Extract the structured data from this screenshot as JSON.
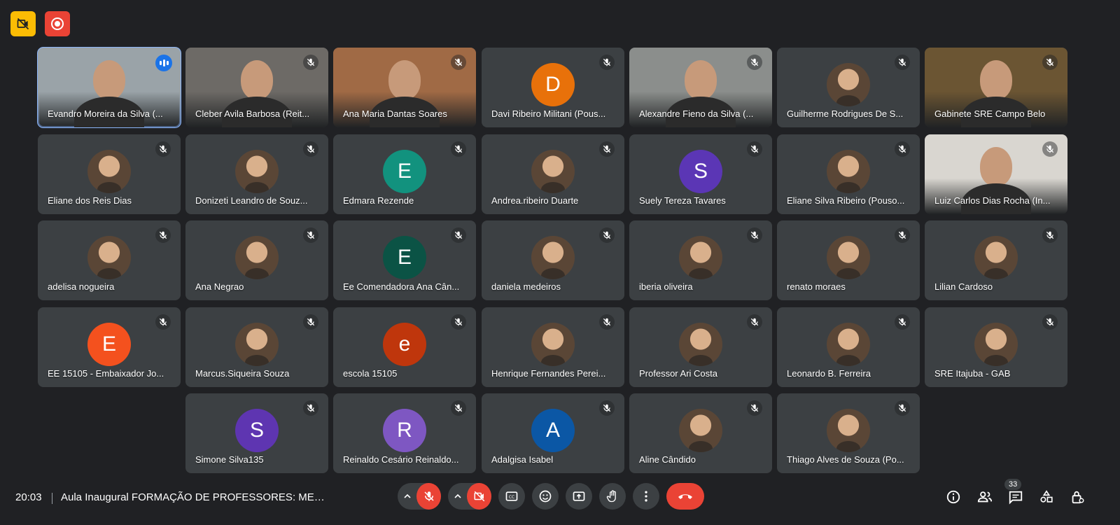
{
  "top_badges": {
    "camera_off": "camera-off-icon",
    "recording": "record-icon"
  },
  "participants": [
    {
      "name": "Evandro Moreira da Silva (...",
      "kind": "video",
      "bg": "#9aa3a8",
      "speaking": true
    },
    {
      "name": "Cleber Avila Barbosa (Reit...",
      "kind": "video",
      "bg": "#6d6a66"
    },
    {
      "name": "Ana Maria Dantas Soares",
      "kind": "video",
      "bg": "#a06a45"
    },
    {
      "name": "Davi Ribeiro Militani (Pous...",
      "kind": "letter",
      "letter": "D",
      "color": "#e8710a"
    },
    {
      "name": "Alexandre Fieno da Silva (...",
      "kind": "video",
      "bg": "#8b8e8c"
    },
    {
      "name": "Guilherme Rodrigues De S...",
      "kind": "photo"
    },
    {
      "name": "Gabinete SRE Campo Belo",
      "kind": "video",
      "bg": "#6b5533"
    },
    {
      "name": "Eliane dos Reis Dias",
      "kind": "photo"
    },
    {
      "name": "Donizeti Leandro de Souz...",
      "kind": "photo"
    },
    {
      "name": "Edmara Rezende",
      "kind": "letter",
      "letter": "E",
      "color": "#12927e"
    },
    {
      "name": "Andrea.ribeiro Duarte",
      "kind": "photo"
    },
    {
      "name": "Suely Tereza Tavares",
      "kind": "letter",
      "letter": "S",
      "color": "#5b36b5"
    },
    {
      "name": "Eliane Silva Ribeiro (Pouso...",
      "kind": "photo"
    },
    {
      "name": "Luiz Carlos Dias Rocha (In...",
      "kind": "video",
      "bg": "#d9d6d0"
    },
    {
      "name": "adelisa nogueira",
      "kind": "photo"
    },
    {
      "name": "Ana Negrao",
      "kind": "photo"
    },
    {
      "name": "Ee Comendadora Ana Cân...",
      "kind": "letter",
      "letter": "E",
      "color": "#0b5345"
    },
    {
      "name": "daniela medeiros",
      "kind": "photo"
    },
    {
      "name": "iberia oliveira",
      "kind": "photo"
    },
    {
      "name": "renato moraes",
      "kind": "photo"
    },
    {
      "name": "Lilian Cardoso",
      "kind": "photo"
    },
    {
      "name": "EE 15105 - Embaixador Jo...",
      "kind": "letter",
      "letter": "E",
      "color": "#f4511e"
    },
    {
      "name": "Marcus.Siqueira Souza",
      "kind": "photo"
    },
    {
      "name": "escola 15105",
      "kind": "letter",
      "letter": "e",
      "color": "#bf360c"
    },
    {
      "name": "Henrique Fernandes Perei...",
      "kind": "photo"
    },
    {
      "name": "Professor Ari Costa",
      "kind": "photo"
    },
    {
      "name": "Leonardo B. Ferreira",
      "kind": "photo"
    },
    {
      "name": "SRE Itajuba - GAB",
      "kind": "photo"
    },
    {
      "name": "Simone Silva135",
      "kind": "letter",
      "letter": "S",
      "color": "#5e35b1"
    },
    {
      "name": "Reinaldo Cesário Reinaldo...",
      "kind": "letter",
      "letter": "R",
      "color": "#7e57c2"
    },
    {
      "name": "Adalgisa Isabel",
      "kind": "letter",
      "letter": "A",
      "color": "#0b57a5"
    },
    {
      "name": "Aline Cândido",
      "kind": "photo"
    },
    {
      "name": "Thiago Alves de Souza (Po...",
      "kind": "photo"
    }
  ],
  "bottom_bar": {
    "time": "20:03",
    "meeting_title": "Aula Inaugural FORMAÇÃO DE PROFESSORES: MET...",
    "participant_count": "33",
    "controls": [
      "mic-off-icon",
      "camera-off-icon",
      "captions-icon",
      "emoji-icon",
      "present-icon",
      "raise-hand-icon",
      "more-options-icon",
      "hang-up-icon"
    ],
    "right_icons": [
      "info-icon",
      "people-icon",
      "chat-icon",
      "activities-icon",
      "host-controls-icon"
    ]
  }
}
